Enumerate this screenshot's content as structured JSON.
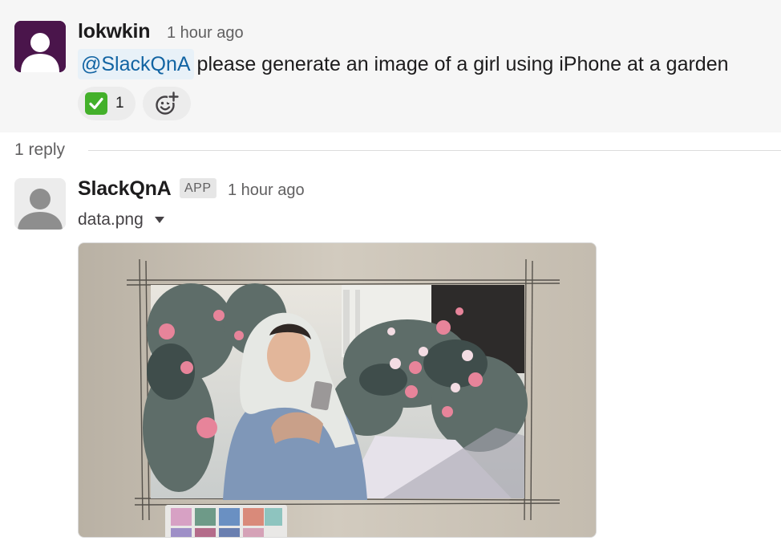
{
  "parent": {
    "sender": "lokwkin",
    "timestamp": "1 hour ago",
    "mention": "@SlackQnA",
    "text": "please generate an image of a girl using iPhone at a garden",
    "reactions": [
      {
        "emoji": "white-check-mark-icon",
        "count": "1"
      }
    ]
  },
  "thread": {
    "reply_count": "1 reply"
  },
  "reply": {
    "sender": "SlackQnA",
    "badge": "APP",
    "timestamp": "1 hour ago",
    "file_name": "data.png"
  },
  "colors": {
    "mention_bg": "#e8f1f8",
    "mention_text": "#1264a3",
    "parent_bg": "#f6f6f6",
    "avatar_purple": "#4a154b",
    "check_green": "#43b02a"
  }
}
